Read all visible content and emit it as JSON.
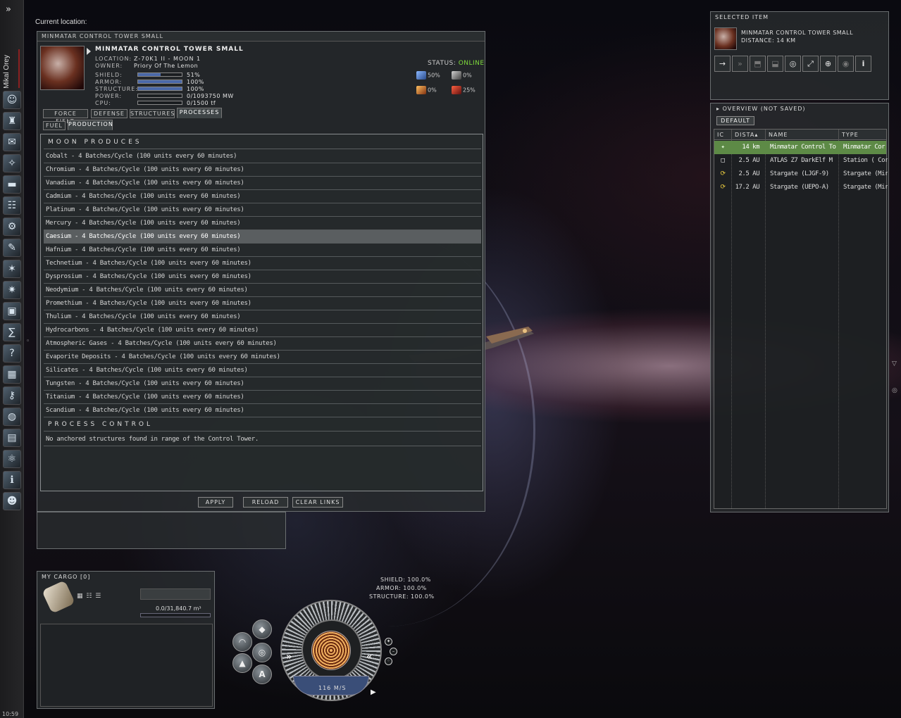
{
  "pilot": {
    "name": "Mikal Orey"
  },
  "clock": "10:59",
  "neocom_icons": [
    "character-sheet-icon",
    "corporation-icon",
    "mail-icon",
    "assets-icon",
    "notepad-icon",
    "people-places-icon",
    "market-icon",
    "journal-icon",
    "map-icon",
    "starmap-icon",
    "ship-hangar-icon",
    "skills-icon",
    "help-icon",
    "calculator-icon",
    "fitting-icon",
    "browser-icon",
    "wallet-icon",
    "science-icon",
    "info-icon",
    "chat-icon"
  ],
  "current_location": {
    "label": "Current location:"
  },
  "info_window": {
    "title": "MINMATAR CONTROL TOWER SMALL",
    "item_name": "MINMATAR CONTROL TOWER SMALL",
    "location_label": "LOCATION:",
    "location_value": "Z-70K1 II - MOON 1",
    "owner_label": "OWNER:",
    "owner_value": "Priory Of The Lemon",
    "status_label": "STATUS:",
    "status_value": "ONLINE",
    "status_color": "#7fdc3c",
    "stats": [
      {
        "label": "SHIELD:",
        "value": "51%",
        "fill": 0.51
      },
      {
        "label": "ARMOR:",
        "value": "100%",
        "fill": 1.0
      },
      {
        "label": "STRUCTURE:",
        "value": "100%",
        "fill": 1.0
      },
      {
        "label": "POWER:",
        "value": "0/1093750 MW",
        "fill": 0.0
      },
      {
        "label": "CPU:",
        "value": "0/1500 tf",
        "fill": 0.0
      }
    ],
    "resistances": [
      {
        "icon": "em-resist-icon",
        "value": "50%"
      },
      {
        "icon": "thermal-resist-icon",
        "value": "0%"
      },
      {
        "icon": "kinetic-resist-icon",
        "value": "0%"
      },
      {
        "icon": "explosive-resist-icon",
        "value": "25%"
      }
    ],
    "tabs_top": [
      "FORCE FIELD",
      "DEFENSE",
      "STRUCTURES",
      "PROCESSES"
    ],
    "tabs_sub": [
      "FUEL",
      "PRODUCTION"
    ],
    "moon_produces_header": "MOON PRODUCES",
    "minerals": [
      "Cobalt - 4 Batches/Cycle (100 units every 60 minutes)",
      "Chromium - 4 Batches/Cycle (100 units every 60 minutes)",
      "Vanadium - 4 Batches/Cycle (100 units every 60 minutes)",
      "Cadmium - 4 Batches/Cycle (100 units every 60 minutes)",
      "Platinum - 4 Batches/Cycle (100 units every 60 minutes)",
      "Mercury - 4 Batches/Cycle (100 units every 60 minutes)",
      "Caesium - 4 Batches/Cycle (100 units every 60 minutes)",
      "Hafnium - 4 Batches/Cycle (100 units every 60 minutes)",
      "Technetium - 4 Batches/Cycle (100 units every 60 minutes)",
      "Dysprosium - 4 Batches/Cycle (100 units every 60 minutes)",
      "Neodymium - 4 Batches/Cycle (100 units every 60 minutes)",
      "Promethium - 4 Batches/Cycle (100 units every 60 minutes)",
      "Thulium - 4 Batches/Cycle (100 units every 60 minutes)",
      "Hydrocarbons - 4 Batches/Cycle (100 units every 60 minutes)",
      "Atmospheric Gases - 4 Batches/Cycle (100 units every 60 minutes)",
      "Evaporite Deposits - 4 Batches/Cycle (100 units every 60 minutes)",
      "Silicates - 4 Batches/Cycle (100 units every 60 minutes)",
      "Tungsten - 4 Batches/Cycle (100 units every 60 minutes)",
      "Titanium - 4 Batches/Cycle (100 units every 60 minutes)",
      "Scandium - 4 Batches/Cycle (100 units every 60 minutes)"
    ],
    "selected_mineral": "Caesium",
    "process_control_header": "PROCESS CONTROL",
    "process_message": "No anchored structures found in range of the Control Tower.",
    "buttons": {
      "apply": "APPLY",
      "reload": "RELOAD",
      "clear_links": "CLEAR LINKS"
    }
  },
  "cargo": {
    "title": "MY CARGO [0]",
    "view_modes": "▦ ☷ ☰",
    "capacity": "0.0/31,840.7 m³",
    "fill": 0.0
  },
  "hud": {
    "shield": "SHIELD: 100.0%",
    "armor": "ARMOR: 100.0%",
    "structure": "STRUCTURE: 100.0%",
    "speed": "116 M/S",
    "autopilot_label": "A"
  },
  "selected_item": {
    "title": "SELECTED ITEM",
    "name": "MINMATAR CONTROL TOWER SMALL",
    "distance": "DISTANCE: 14 KM",
    "actions": [
      "approach-icon",
      "warp-to-icon",
      "jump-icon",
      "dock-icon",
      "orbit-icon",
      "keep-at-range-icon",
      "lock-target-icon",
      "look-at-icon",
      "show-info-icon"
    ]
  },
  "overview": {
    "title": "OVERVIEW (NOT SAVED)",
    "tab": "DEFAULT",
    "columns": [
      "IC",
      "DISTA",
      "NAME",
      "TYPE"
    ],
    "rows": [
      {
        "icon": "control-tower-icon",
        "distance": "14 km",
        "name": "Minmatar Control To",
        "type": "Minmatar Cor"
      },
      {
        "icon": "station-icon",
        "distance": "2.5 AU",
        "name": "ATLAS Z7 DarkElf M",
        "type": "Station ( Cor"
      },
      {
        "icon": "stargate-icon",
        "distance": "2.5 AU",
        "name": "Stargate (LJGF-9)",
        "type": "Stargate (Mir"
      },
      {
        "icon": "stargate-icon",
        "distance": "17.2 AU",
        "name": "Stargate (UEPO-A)",
        "type": "Stargate (Mir"
      }
    ]
  }
}
